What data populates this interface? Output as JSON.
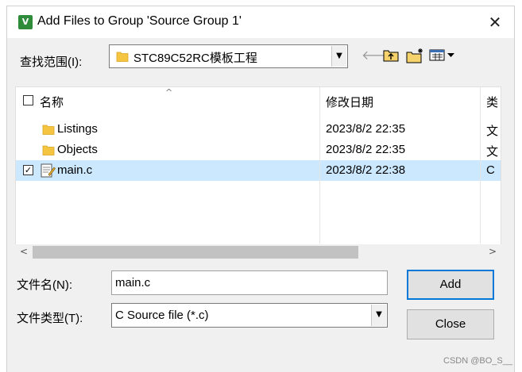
{
  "window": {
    "title": "Add Files to Group 'Source Group 1'",
    "app_icon_text": "V",
    "close_glyph": "✕"
  },
  "look_in": {
    "label": "查找范围(I):",
    "value": "STC89C52RC模板工程"
  },
  "toolbar": {
    "icons": [
      "back-arrow-icon",
      "up-one-level-icon",
      "new-folder-icon",
      "view-menu-icon"
    ]
  },
  "file_list": {
    "columns": [
      "名称",
      "修改日期",
      "类"
    ],
    "header_checked": false,
    "rows": [
      {
        "name": "Listings",
        "date": "2023/8/2 22:35",
        "type": "文",
        "kind": "folder",
        "checked": false,
        "selected": false
      },
      {
        "name": "Objects",
        "date": "2023/8/2 22:35",
        "type": "文",
        "kind": "folder",
        "checked": false,
        "selected": false
      },
      {
        "name": "main.c",
        "date": "2023/8/2 22:38",
        "type": "C",
        "kind": "c-file",
        "checked": true,
        "selected": true
      }
    ]
  },
  "file_name": {
    "label": "文件名(N):",
    "value": "main.c"
  },
  "file_type": {
    "label": "文件类型(T):",
    "value": "C Source file (*.c)"
  },
  "buttons": {
    "add": "Add",
    "close": "Close"
  },
  "watermark": "CSDN @BO_S__",
  "colors": {
    "selected_row": "#cce8ff",
    "default_button_border": "#0078d7",
    "folder": "#f5c542"
  }
}
